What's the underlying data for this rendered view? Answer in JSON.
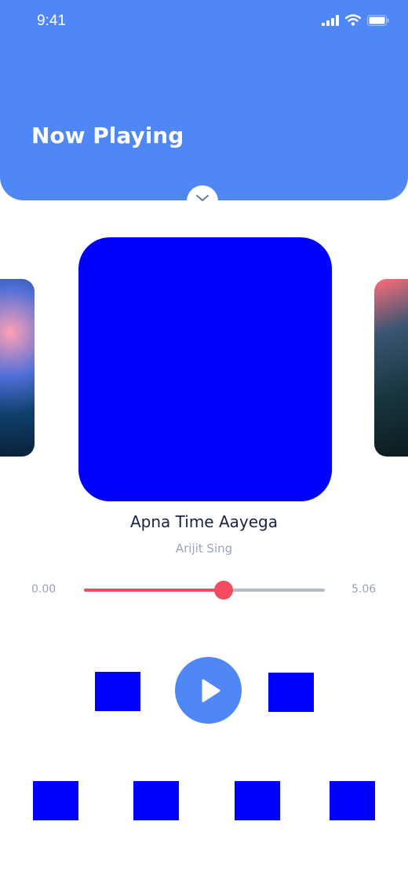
{
  "status_bar": {
    "time": "9:41",
    "icons": [
      "cellular-signal-icon",
      "wifi-icon",
      "battery-icon"
    ]
  },
  "header": {
    "title": "Now Playing",
    "color": "#4f87f7"
  },
  "player": {
    "song_title": "Apna Time Aayega",
    "artist": "Arijit Sing",
    "time_elapsed": "0.00",
    "time_total": "5.06",
    "progress_fraction": 0.58,
    "progress_color": "#f34b62",
    "is_playing": false
  }
}
